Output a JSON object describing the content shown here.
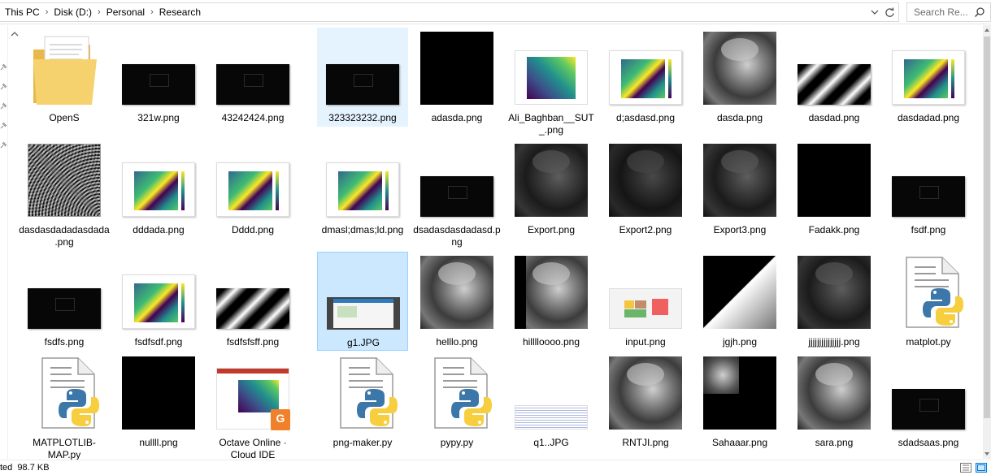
{
  "address_bar": {
    "crumbs": [
      "This PC",
      "Disk (D:)",
      "Personal",
      "Research"
    ],
    "search_placeholder": "Search Re..."
  },
  "status_bar": {
    "left_text": "ted  98.7 KB"
  },
  "colors": {
    "selection": "#cce8ff",
    "hover": "#e5f3ff",
    "accent": "#0078d7"
  },
  "files": [
    {
      "name": "OpenS",
      "thumb": "folder"
    },
    {
      "name": "321w.png",
      "thumb": "black-wide"
    },
    {
      "name": "43242424.png",
      "thumb": "black-wide"
    },
    {
      "name": "323323232.png",
      "thumb": "black-wide",
      "state": "hover"
    },
    {
      "name": "adasda.png",
      "thumb": "black-square"
    },
    {
      "name": "Ali_Baghban__SUT_.png",
      "thumb": "viridis-grid"
    },
    {
      "name": "d;asdasd.png",
      "thumb": "viridis-plot"
    },
    {
      "name": "dasda.png",
      "thumb": "lena-gray"
    },
    {
      "name": "dasdad.png",
      "thumb": "stripes"
    },
    {
      "name": "dasdadad.png",
      "thumb": "viridis-plot"
    },
    {
      "name": "dasdasdadadasdada.png",
      "thumb": "fractal"
    },
    {
      "name": "dddada.png",
      "thumb": "viridis-plot"
    },
    {
      "name": "Dddd.png",
      "thumb": "viridis-plot"
    },
    {
      "name": "dmasl;dmas;ld.png",
      "thumb": "viridis-plot"
    },
    {
      "name": "dsadasdasdadasd.png",
      "thumb": "black-wide"
    },
    {
      "name": "Export.png",
      "thumb": "lena-dark"
    },
    {
      "name": "Export2.png",
      "thumb": "lena-darker"
    },
    {
      "name": "Export3.png",
      "thumb": "lena-dark"
    },
    {
      "name": "Fadakk.png",
      "thumb": "black-square"
    },
    {
      "name": "fsdf.png",
      "thumb": "black-wide"
    },
    {
      "name": "fsdfs.png",
      "thumb": "black-wide"
    },
    {
      "name": "fsdfsdf.png",
      "thumb": "viridis-plot"
    },
    {
      "name": "fsdfsfsff.png",
      "thumb": "stripes"
    },
    {
      "name": "g1.JPG",
      "thumb": "screenshot",
      "state": "selected"
    },
    {
      "name": "helllo.png",
      "thumb": "lena-gray"
    },
    {
      "name": "hilllloooo.png",
      "thumb": "lena-crop"
    },
    {
      "name": "input.png",
      "thumb": "input"
    },
    {
      "name": "jgjh.png",
      "thumb": "diagonal"
    },
    {
      "name": "jjjjjjjjjjjjjjj.png",
      "thumb": "lena-dark"
    },
    {
      "name": "matplot.py",
      "thumb": "python"
    },
    {
      "name": "MATPLOTLIB-MAP.py",
      "thumb": "python"
    },
    {
      "name": "nullll.png",
      "thumb": "black-square"
    },
    {
      "name": "Octave Online · Cloud IDE",
      "thumb": "octave"
    },
    {
      "name": "png-maker.py",
      "thumb": "python"
    },
    {
      "name": "pypy.py",
      "thumb": "python"
    },
    {
      "name": "q1..JPG",
      "thumb": "text"
    },
    {
      "name": "RNTJI.png",
      "thumb": "lena-gray"
    },
    {
      "name": "Sahaaar.png",
      "thumb": "sahaar"
    },
    {
      "name": "sara.png",
      "thumb": "lena-gray"
    },
    {
      "name": "sdadsaas.png",
      "thumb": "black-wide"
    }
  ]
}
